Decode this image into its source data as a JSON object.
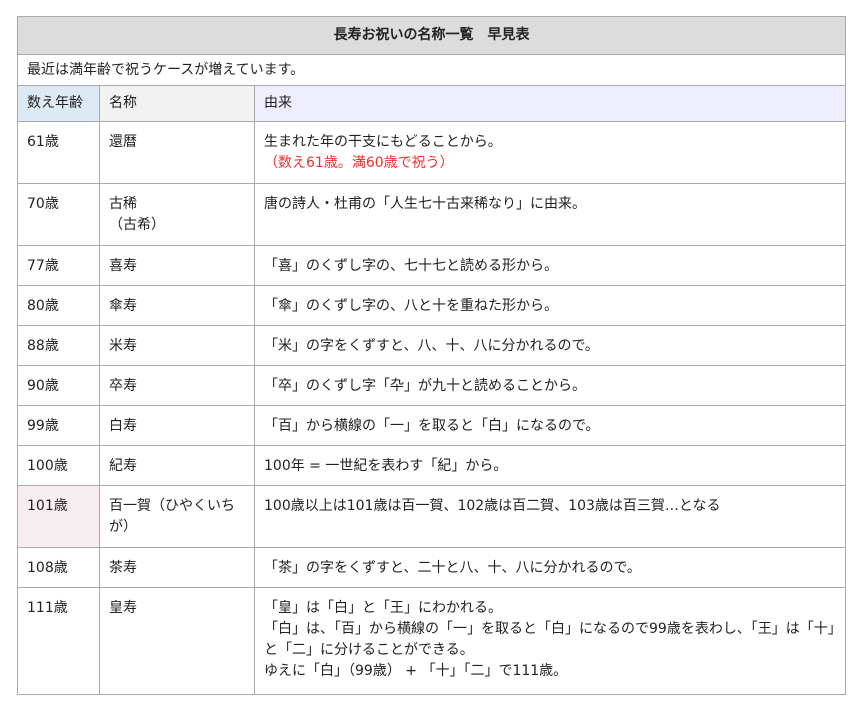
{
  "table": {
    "title": "長寿お祝いの名称一覧　早見表",
    "note": "最近は満年齢で祝うケースが増えています。",
    "headers": {
      "age": "数え年齢",
      "name": "名称",
      "origin": "由来"
    },
    "rows": [
      {
        "age": "61歳",
        "name": "還暦",
        "name2": "",
        "origin": "生まれた年の干支にもどることから。",
        "origin_red": "（数え61歳。満60歳で祝う）"
      },
      {
        "age": "70歳",
        "name": "古稀",
        "name2": "（古希）",
        "origin": "唐の詩人・杜甫の「人生七十古来稀なり」に由来。"
      },
      {
        "age": "77歳",
        "name": "喜寿",
        "origin": "「喜」のくずし字の、七十七と読める形から。"
      },
      {
        "age": "80歳",
        "name": "傘寿",
        "origin": "「傘」のくずし字の、八と十を重ねた形から。"
      },
      {
        "age": "88歳",
        "name": "米寿",
        "origin": "「米」の字をくずすと、八、十、八に分かれるので。"
      },
      {
        "age": "90歳",
        "name": "卒寿",
        "origin": "「卒」のくずし字「卆」が九十と読めることから。"
      },
      {
        "age": "99歳",
        "name": "白寿",
        "origin": "「百」から横線の「一」を取ると「白」になるので。"
      },
      {
        "age": "100歳",
        "name": "紀寿",
        "origin": "100年 = 一世紀を表わす「紀」から。"
      },
      {
        "age": "101歳",
        "name": "百一賀（ひやくいちが）",
        "origin": "100歳以上は101歳は百一賀、102歳は百二賀、103歳は百三賀…となる"
      },
      {
        "age": "108歳",
        "name": "茶寿",
        "origin": "「茶」の字をくずすと、二十と八、十、八に分かれるので。"
      },
      {
        "age": "111歳",
        "name": "皇寿",
        "origin_lines": [
          "「皇」は「白」と「王」にわかれる。",
          "「白」は、「百」から横線の「一」を取ると「白」になるので99歳を表わし、「王」は「十」と「二」に分けることができる。",
          "ゆえに「白」（99歳） + 「十」「二」で111歳。"
        ]
      }
    ]
  },
  "colors": {
    "title_bg": "#dcdcdc",
    "age_header_bg": "#dde9f5",
    "origin_header_bg": "#efeefe",
    "highlight_row_bg": "#f7eef2",
    "note_red": "#e8332e",
    "border": "#aaaaaa"
  }
}
